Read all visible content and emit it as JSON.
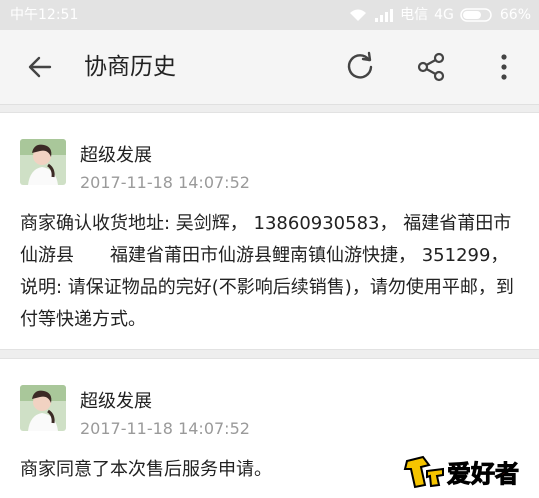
{
  "status_bar": {
    "time": "中午12:51",
    "carrier": "电信",
    "network": "4G",
    "battery": "66%"
  },
  "toolbar": {
    "title": "协商历史",
    "icons": [
      "back-arrow-icon",
      "refresh-icon",
      "share-icon",
      "more-vert-icon"
    ]
  },
  "messages": [
    {
      "name": "超级发展",
      "time": "2017-11-18 14:07:52",
      "text": "商家确认收货地址: 吴剑辉， 13860930583， 福建省莆田市仙游县　　福建省莆田市仙游县鲤南镇仙游快捷， 351299，说明: 请保证物品的完好(不影响后续销售)，请勿使用平邮，到付等快递方式。"
    },
    {
      "name": "超级发展",
      "time": "2017-11-18 14:07:52",
      "text": "商家同意了本次售后服务申请。"
    }
  ],
  "watermark": {
    "text": "爱好者"
  },
  "colors": {
    "status_bg": "#e3e3e3",
    "toolbar_bg": "#f5f5f5",
    "page_bg": "#eeeeee",
    "time_gray": "#9a9a9a"
  }
}
